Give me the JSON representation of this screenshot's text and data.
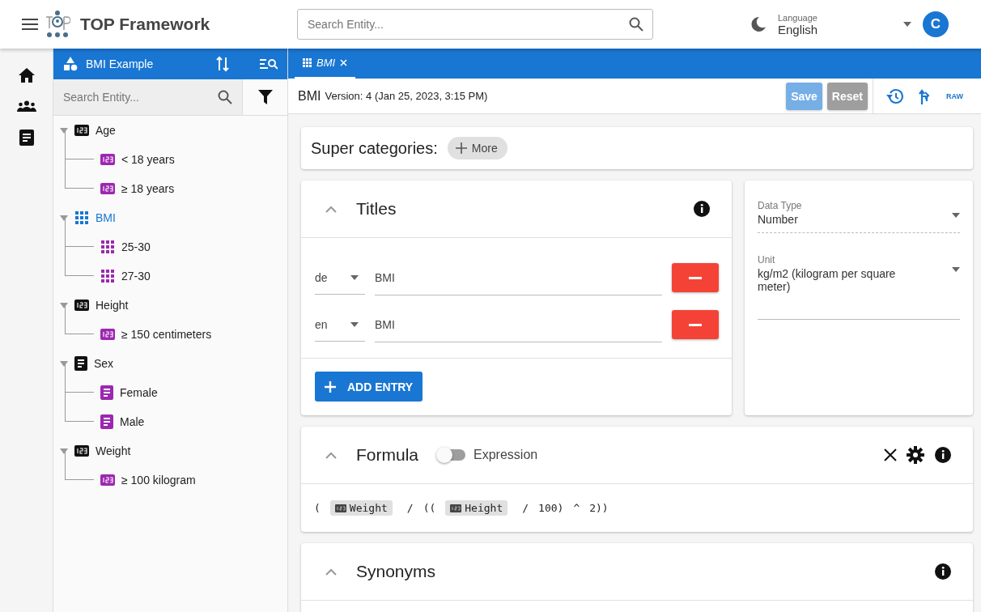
{
  "header": {
    "title": "TOP Framework",
    "search": {
      "placeholder": "Search Entity..."
    },
    "language": {
      "label": "Language",
      "value": "English"
    },
    "avatar": "C"
  },
  "rail": [
    {
      "kind": "home"
    },
    {
      "kind": "people"
    },
    {
      "kind": "document"
    }
  ],
  "tree_panel": {
    "title": "BMI Example",
    "search": {
      "placeholder": "Search Entity..."
    },
    "items": [
      {
        "label": "Age",
        "kind": "number",
        "selected": false,
        "expanded": true,
        "children": [
          {
            "label": "< 18 years",
            "kind": "number",
            "selected": false
          },
          {
            "label": "≥ 18 years",
            "kind": "number",
            "selected": false
          }
        ]
      },
      {
        "label": "BMI",
        "kind": "calculated",
        "selected": true,
        "expanded": true,
        "children": [
          {
            "label": "25-30",
            "kind": "calculated",
            "selected": false
          },
          {
            "label": "27-30",
            "kind": "calculated",
            "selected": false
          }
        ]
      },
      {
        "label": "Height",
        "kind": "number",
        "selected": false,
        "expanded": true,
        "children": [
          {
            "label": "≥ 150 centimeters",
            "kind": "number",
            "selected": false
          }
        ]
      },
      {
        "label": "Sex",
        "kind": "text",
        "selected": false,
        "expanded": true,
        "children": [
          {
            "label": "Female",
            "kind": "text",
            "selected": false
          },
          {
            "label": "Male",
            "kind": "text",
            "selected": false
          }
        ]
      },
      {
        "label": "Weight",
        "kind": "number",
        "selected": false,
        "expanded": true,
        "children": [
          {
            "label": "≥ 100 kilogram",
            "kind": "number",
            "selected": false
          }
        ]
      }
    ]
  },
  "tabs": [
    {
      "label": "BMI",
      "selected": true
    }
  ],
  "toolbar": {
    "name": "BMI",
    "version": "Version: 4 (Jan 25, 2023, 3:15 PM)",
    "buttons": [
      {
        "label": "Save",
        "kind": "primary",
        "disabled": true
      },
      {
        "label": "Reset",
        "kind": "secondary",
        "disabled": true
      }
    ],
    "raw": "RAW"
  },
  "super_categories": {
    "label": "Super categories:",
    "more": "More"
  },
  "titles": {
    "heading": "Titles",
    "entries": [
      {
        "language": "de",
        "value": "BMI"
      },
      {
        "language": "en",
        "value": "BMI"
      }
    ],
    "add": "ADD ENTRY"
  },
  "details": {
    "data_type": {
      "label": "Data Type",
      "value": "Number"
    },
    "unit": {
      "label": "Unit",
      "value": "kg/m2 (kilogram per square meter)"
    }
  },
  "formula": {
    "heading": "Formula",
    "expression": {
      "label": "Expression",
      "on": false
    },
    "tokens": [
      {
        "kind": "text",
        "text": "("
      },
      {
        "kind": "entity",
        "text": "Weight"
      },
      {
        "kind": "text",
        "text": "/"
      },
      {
        "kind": "text",
        "text": "(("
      },
      {
        "kind": "entity",
        "text": "Height"
      },
      {
        "kind": "text",
        "text": "/"
      },
      {
        "kind": "text",
        "text": "100)"
      },
      {
        "kind": "text",
        "text": "^"
      },
      {
        "kind": "text",
        "text": "2))"
      }
    ]
  },
  "synonyms": {
    "heading": "Synonyms"
  }
}
